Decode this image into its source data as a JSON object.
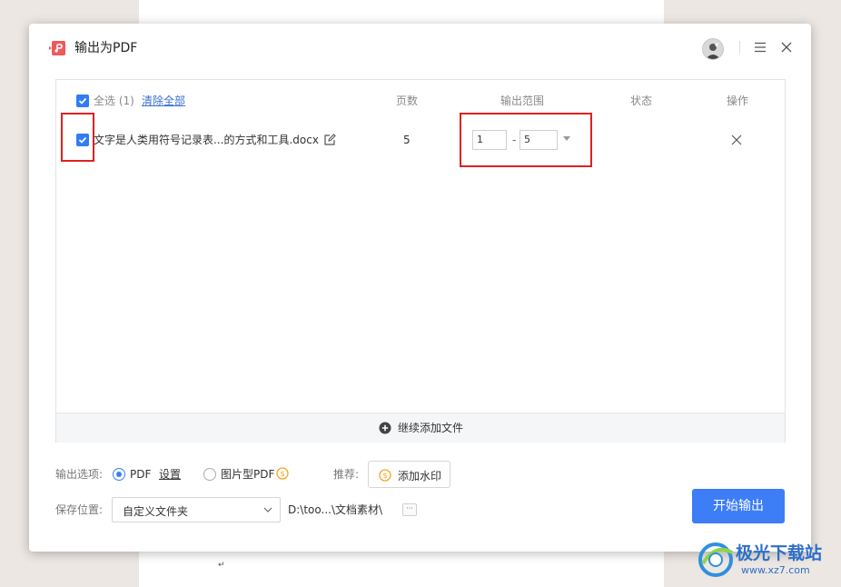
{
  "background": {
    "paragraph_mark": "↵"
  },
  "dialog": {
    "title": "输出为PDF",
    "icons": {
      "logo": "pdf-app-logo",
      "avatar": "user-avatar",
      "menu": "menu-icon",
      "close": "close-icon"
    }
  },
  "table": {
    "select_all_label": "全选 (1)",
    "clear_all_label": "清除全部",
    "headers": {
      "pages": "页数",
      "range": "输出范围",
      "status": "状态",
      "action": "操作"
    },
    "rows": [
      {
        "checked": true,
        "filename": "文字是人类用符号记录表...的方式和工具.docx",
        "pages": "5",
        "range_from": "1",
        "range_to": "5",
        "status": ""
      }
    ],
    "add_more_label": "继续添加文件"
  },
  "options": {
    "output_label": "输出选项:",
    "pdf_label": "PDF",
    "settings_label": "设置",
    "image_pdf_label": "图片型PDF",
    "selected": "PDF",
    "recommend_label": "推荐:",
    "watermark_label": "添加水印"
  },
  "save": {
    "label": "保存位置:",
    "folder_option": "自定义文件夹",
    "path": "D:\\too...\\文档素材\\",
    "more_label": "···"
  },
  "start_label": "开始输出",
  "watermark": {
    "name": "极光下载站",
    "url": "www.xz7.com"
  },
  "colors": {
    "accent": "#3d7df6",
    "highlight": "#e02020",
    "logo": "#ee5a5a",
    "premium": "#f5a623"
  }
}
